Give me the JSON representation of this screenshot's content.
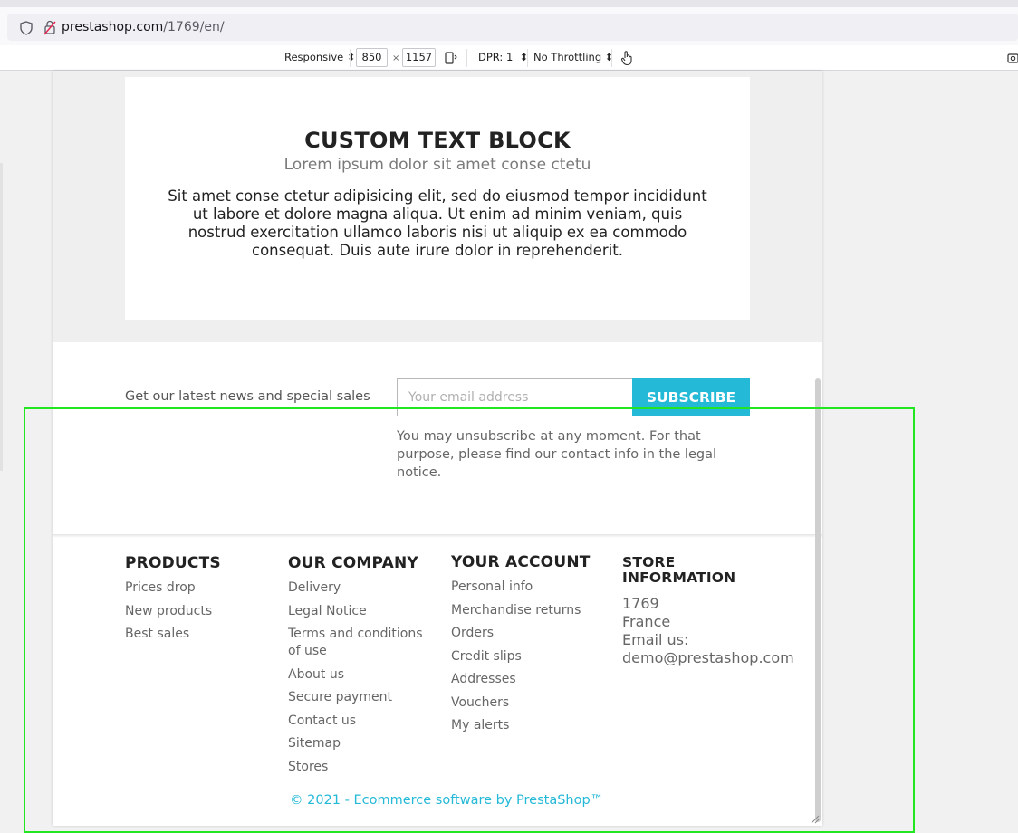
{
  "browser": {
    "url_host": "prestashop.com",
    "url_path": "/1769/en/"
  },
  "devtools": {
    "mode": "Responsive",
    "width": "850",
    "times": "×",
    "height": "1157",
    "dpr": "DPR: 1",
    "throttling": "No Throttling"
  },
  "text_block": {
    "title": "CUSTOM TEXT BLOCK",
    "subtitle": "Lorem ipsum dolor sit amet conse ctetu",
    "body": "Sit amet conse ctetur adipisicing elit, sed do eiusmod tempor incididunt ut labore et dolore magna aliqua. Ut enim ad minim veniam, quis nostrud exercitation ullamco laboris nisi ut aliquip ex ea commodo consequat. Duis aute irure dolor in reprehenderit."
  },
  "newsletter": {
    "label": "Get our latest news and special sales",
    "email_placeholder": "Your email address",
    "subscribe_label": "SUBSCRIBE",
    "note": "You may unsubscribe at any moment. For that purpose, please find our contact info in the legal notice."
  },
  "footer": {
    "products": {
      "title": "PRODUCTS",
      "links": [
        "Prices drop",
        "New products",
        "Best sales"
      ]
    },
    "company": {
      "title": "OUR COMPANY",
      "links": [
        "Delivery",
        "Legal Notice",
        "Terms and conditions of use",
        "About us",
        "Secure payment",
        "Contact us",
        "Sitemap",
        "Stores"
      ]
    },
    "account": {
      "title": "YOUR ACCOUNT",
      "links": [
        "Personal info",
        "Merchandise returns",
        "Orders",
        "Credit slips",
        "Addresses",
        "Vouchers",
        "My alerts"
      ]
    },
    "store": {
      "title": "STORE INFORMATION",
      "line1": "1769",
      "line2": "France",
      "line3": "Email us:",
      "email": "demo@prestashop.com"
    },
    "copyright": "© 2021 - Ecommerce software by PrestaShop™"
  }
}
